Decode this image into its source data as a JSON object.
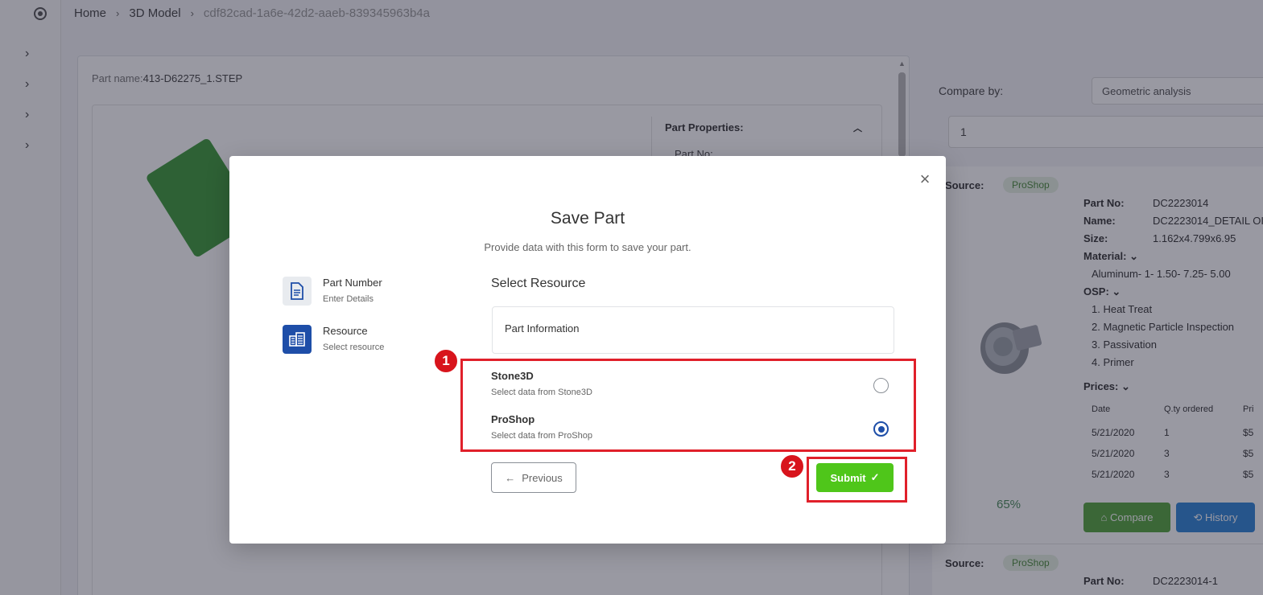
{
  "breadcrumb": {
    "home": "Home",
    "model": "3D Model",
    "id": "cdf82cad-1a6e-42d2-aaeb-839345963b4a"
  },
  "viewer": {
    "part_name_label": "Part name:",
    "part_name_value": "413-D62275_1.STEP",
    "properties_title": "Part Properties:",
    "part_no_label": "Part No:"
  },
  "compare": {
    "label": "Compare by:",
    "select_value": "Geometric analysis",
    "input_value": "1"
  },
  "result_card": {
    "source_label": "Source:",
    "source_chip": "ProShop",
    "part_no_label": "Part No:",
    "part_no": "DC2223014",
    "name_label": "Name:",
    "name": "DC2223014_DETAIL OI",
    "size_label": "Size:",
    "size": "1.162x4.799x6.95",
    "material_label": "Material:",
    "material": "Aluminum- 1- 1.50- 7.25- 5.00",
    "osp_label": "OSP:",
    "osp_items": [
      "1. Heat Treat",
      "2. Magnetic Particle Inspection",
      "3. Passivation",
      "4. Primer"
    ],
    "prices_label": "Prices:",
    "price_headers": [
      "Date",
      "Q.ty ordered",
      "Pri"
    ],
    "price_rows": [
      [
        "5/21/2020",
        "1",
        "$5"
      ],
      [
        "5/21/2020",
        "3",
        "$5"
      ],
      [
        "5/21/2020",
        "3",
        "$5"
      ]
    ],
    "similarity": "65%",
    "compare_button": "Compare",
    "history_button": "History"
  },
  "result_card_2": {
    "source_label": "Source:",
    "source_chip": "ProShop",
    "part_no_label": "Part No:",
    "part_no": "DC2223014-1"
  },
  "modal": {
    "title": "Save Part",
    "subtitle": "Provide data with this form to save your part.",
    "steps": [
      {
        "label": "Part Number",
        "desc": "Enter Details"
      },
      {
        "label": "Resource",
        "desc": "Select resource"
      }
    ],
    "section_title": "Select Resource",
    "info_box": "Part Information",
    "options": [
      {
        "name": "Stone3D",
        "desc": "Select data from Stone3D",
        "checked": false
      },
      {
        "name": "ProShop",
        "desc": "Select data from ProShop",
        "checked": true
      }
    ],
    "previous_button": "Previous",
    "submit_button": "Submit"
  },
  "annotations": {
    "badge_1": "1",
    "badge_2": "2",
    "highlight_color": "#e0202a"
  },
  "colors": {
    "primary": "#1e4ea8",
    "submit": "#4fc61a",
    "compare": "#55a43c",
    "history": "#2f83d6"
  }
}
